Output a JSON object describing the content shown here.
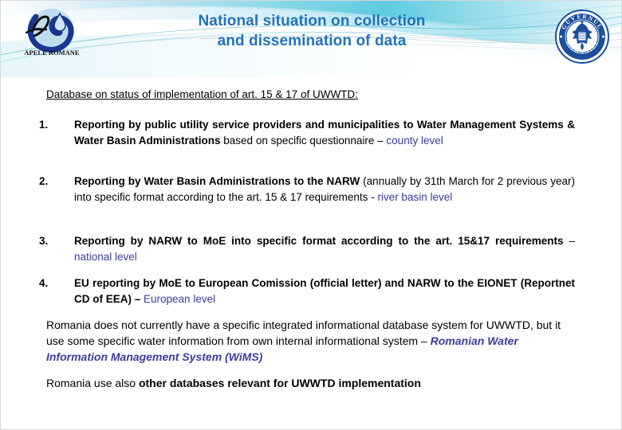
{
  "slide": {
    "title_line_1": "National situation on collection",
    "title_line_2": "and dissemination of data",
    "heading": "Database on status of implementation of art. 15 & 17 of UWWTD:"
  },
  "logos": {
    "left": {
      "name": "apele-romane-logo",
      "caption": "APELE ROMANE",
      "monogram": "AR"
    },
    "right": {
      "name": "guvernul-romaniei-seal",
      "text_top": "GUVERNUL",
      "text_bottom": "ROMANIEI"
    }
  },
  "items": [
    {
      "number": "1.",
      "bold": "Reporting by public utility service providers and municipalities to Water Management Systems & Water Basin Administrations",
      "regular": " based on specific questionnaire – ",
      "blue": "county level"
    },
    {
      "number": "2.",
      "bold": "Reporting by Water Basin Administrations to the NARW",
      "regular": " (annually by 31th March for 2 previous year) into specific format according to the art. 15 & 17 requirements - ",
      "blue": "river basin level"
    },
    {
      "number": "3.",
      "bold": "Reporting by NARW to MoE into specific format according to the art. 15&17 requirements",
      "regular": " – ",
      "blue": "national level"
    },
    {
      "number": "4.",
      "bold": "EU reporting by MoE  to European Comission (official letter) and  NARW to the EIONET (Reportnet CD of EEA) – ",
      "regular": "",
      "blue": "European level"
    }
  ],
  "paragraphs": {
    "p1_regular": "Romania does not currently have a specific integrated informational database system for UWWTD, but it use some specific water information from own internal informational system – ",
    "p1_blue_italic": "Romanian Water Information Management System (WiMS)",
    "p2_regular": "Romania use also ",
    "p2_bold": "other databases relevant for UWWTD implementation"
  },
  "colors": {
    "title_blue": "#2272bb",
    "accent_blue": "#3b3b9e",
    "text_black": "#000000",
    "banner_cyan": "#6fd4e0",
    "banner_light": "#bfe8f2"
  }
}
